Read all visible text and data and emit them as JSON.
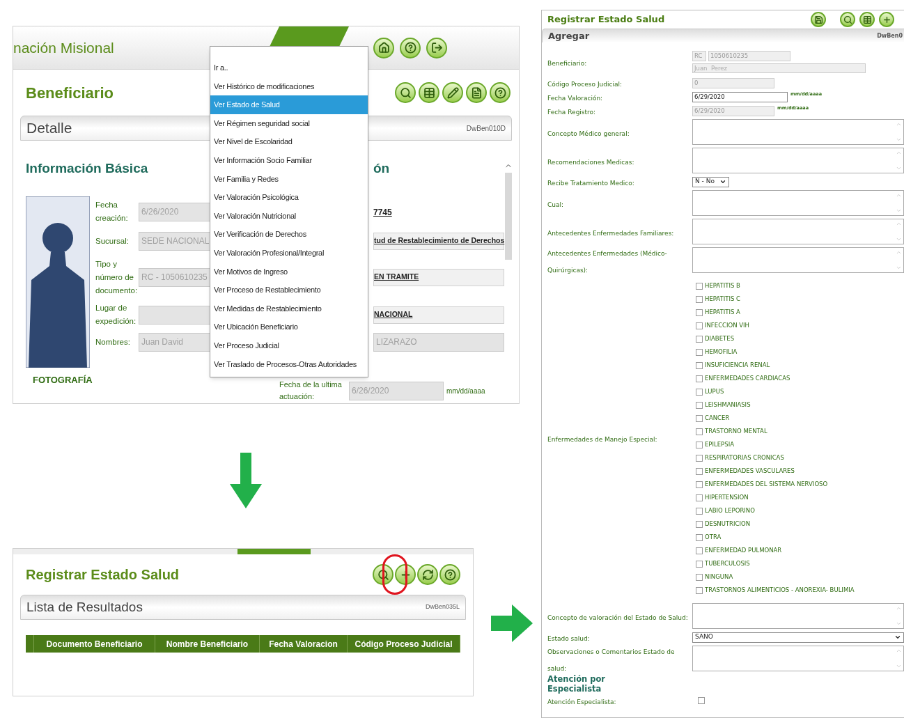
{
  "beneficiary_screen": {
    "header_title": "nación Misional",
    "page_title": "Beneficiario",
    "section_title": "Detalle",
    "section_code": "DwBen010D",
    "subsection_title": "Información Básica",
    "subsection_title_2": "ón",
    "photo_caption": "FOTOGRAFÍA",
    "fields": [
      {
        "label": "Fecha creación:",
        "value": "6/26/2020"
      },
      {
        "label": "Sucursal:",
        "value": "SEDE NACIONAL"
      },
      {
        "label": "Tipo y número de documento:",
        "value": "RC   - 1050610235"
      },
      {
        "label": "Lugar de expedición:"
      },
      {
        "label": "Nombres:",
        "value": "Juan  David"
      }
    ],
    "right_fields": [
      {
        "kind": "link",
        "value": "7745"
      },
      {
        "kind": "linked_field",
        "value": "tud de Restablecimiento de Derechos"
      },
      {
        "kind": "linked_field",
        "value": "EN TRAMITE"
      },
      {
        "kind": "linked_field",
        "value": "NACIONAL"
      },
      {
        "kind": "field",
        "value": "LIZARAZO"
      }
    ],
    "last_action": {
      "label": "Fecha de la ultima actuación:",
      "value": "6/26/2020",
      "hint": "mm/dd/aaaa"
    }
  },
  "context_menu": {
    "items": [
      {
        "label": "Ir a..",
        "selected": false
      },
      {
        "label": "Ver Histórico de modificaciones",
        "selected": false
      },
      {
        "label": "Ver Estado de Salud",
        "selected": true
      },
      {
        "label": "Ver Régimen seguridad social",
        "selected": false
      },
      {
        "label": "Ver Nivel de Escolaridad",
        "selected": false
      },
      {
        "label": "Ver Información Socio Familiar",
        "selected": false
      },
      {
        "label": "Ver Familia y Redes",
        "selected": false
      },
      {
        "label": "Ver Valoración Psicológica",
        "selected": false
      },
      {
        "label": "Ver Valoración Nutricional",
        "selected": false
      },
      {
        "label": "Ver Verificación de Derechos",
        "selected": false
      },
      {
        "label": "Ver Valoración Profesional/Integral",
        "selected": false
      },
      {
        "label": "Ver Motivos de Ingreso",
        "selected": false
      },
      {
        "label": "Ver Proceso de Restablecimiento",
        "selected": false
      },
      {
        "label": "Ver Medidas de Restablecimiento",
        "selected": false
      },
      {
        "label": "Ver Ubicación Beneficiario",
        "selected": false
      },
      {
        "label": "Ver Proceso Judicial",
        "selected": false
      },
      {
        "label": "Ver Traslado de Procesos-Otras Autoridades",
        "selected": false
      }
    ]
  },
  "results_screen": {
    "title": "Registrar Estado Salud",
    "section_title": "Lista de Resultados",
    "section_code": "DwBen035L",
    "columns": [
      "Documento Beneficiario",
      "Nombre Beneficiario",
      "Fecha Valoracion",
      "Código Proceso Judicial"
    ]
  },
  "form_screen": {
    "title": "Registrar Estado Salud",
    "section_title": "Agregar",
    "section_code": "DwBen0",
    "rows": [
      {
        "kind": "beneficiary",
        "label": "Beneficiario:",
        "doc_type": "RC",
        "doc_number": "1050610235",
        "name": "Juan  Perez"
      },
      {
        "kind": "text",
        "label": "Código Proceso Judicial:",
        "value": "0",
        "disabled": true
      },
      {
        "kind": "text",
        "label": "Fecha Valoración:",
        "value": "6/29/2020",
        "disabled": false,
        "hint": "mm/dd/aaaa"
      },
      {
        "kind": "text",
        "label": "Fecha Registro:",
        "value": "6/29/2020",
        "disabled": true,
        "hint": "mm/dd/aaaa"
      },
      {
        "kind": "textarea",
        "label": "Concepto Médico general:"
      },
      {
        "kind": "textarea",
        "label": "Recomendaciones Medicas:"
      },
      {
        "kind": "select",
        "label": "Recibe Tratamiento Medico:",
        "value": "N - No",
        "wide": false
      },
      {
        "kind": "textarea",
        "label": "Cual:"
      },
      {
        "kind": "textarea",
        "label": "Antecedentes Enfermedades Familiares:"
      },
      {
        "kind": "textarea",
        "label": "Antecedentes Enfermedades (Médico-Quirúrgicas):"
      },
      {
        "kind": "checkboxes",
        "label": "Enfermedades de Manejo Especial:",
        "options": [
          {
            "label": "HEPATITIS B",
            "checked": false
          },
          {
            "label": "HEPATITIS C",
            "checked": false
          },
          {
            "label": "HEPATITIS A",
            "checked": false
          },
          {
            "label": "INFECCION VIH",
            "checked": false
          },
          {
            "label": "DIABETES",
            "checked": false
          },
          {
            "label": "HEMOFILIA",
            "checked": false
          },
          {
            "label": "INSUFICIENCIA RENAL",
            "checked": false
          },
          {
            "label": "ENFERMEDADES CARDIACAS",
            "checked": false
          },
          {
            "label": "LUPUS",
            "checked": false
          },
          {
            "label": "LEISHMANIASIS",
            "checked": false
          },
          {
            "label": "CANCER",
            "checked": false
          },
          {
            "label": "TRASTORNO MENTAL",
            "checked": false
          },
          {
            "label": "EPILEPSIA",
            "checked": false
          },
          {
            "label": "RESPIRATORIAS CRONICAS",
            "checked": false
          },
          {
            "label": "ENFERMEDADES VASCULARES",
            "checked": false
          },
          {
            "label": "ENFERMEDADES DEL SISTEMA NERVIOSO",
            "checked": false
          },
          {
            "label": "HIPERTENSION",
            "checked": false
          },
          {
            "label": "LABIO LEPORINO",
            "checked": false
          },
          {
            "label": "DESNUTRICION",
            "checked": false
          },
          {
            "label": "OTRA",
            "checked": false
          },
          {
            "label": "ENFERMEDAD PULMONAR",
            "checked": false
          },
          {
            "label": "TUBERCULOSIS",
            "checked": false
          },
          {
            "label": "NINGUNA",
            "checked": false
          },
          {
            "label": "TRASTORNOS ALIMENTICIOS - ANOREXIA- BULIMIA",
            "checked": false
          }
        ]
      },
      {
        "kind": "textarea",
        "label": "Concepto de valoración del Estado de Salud:"
      },
      {
        "kind": "select",
        "label": "Estado salud:",
        "value": "SANO",
        "wide": true
      },
      {
        "kind": "textarea",
        "label": "Observaciones o Comentarios Estado de salud:"
      },
      {
        "kind": "heading",
        "label": "Atención por Especialista"
      },
      {
        "kind": "checkbox",
        "label": "Atención Especialista:",
        "checked": false
      }
    ]
  }
}
